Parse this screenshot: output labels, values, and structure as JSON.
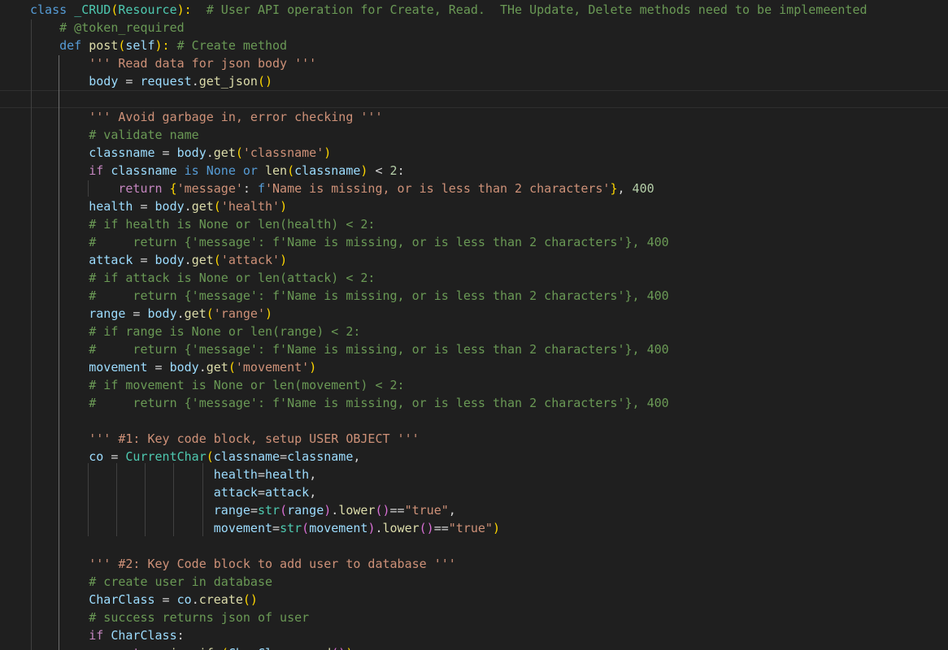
{
  "editor": {
    "language": "python",
    "theme_colors": {
      "background": "#1f1f1f",
      "keyword": "#569cd6",
      "control": "#c586c0",
      "function": "#dcdcaa",
      "variable": "#9cdcfe",
      "class": "#4ec9b0",
      "string": "#ce9178",
      "number": "#b5cea8",
      "comment": "#6a9955",
      "bracket_1": "#ffd700",
      "bracket_2": "#da70d6",
      "bracket_3": "#179fff"
    },
    "lines": [
      [
        [
          "kw",
          "class "
        ],
        [
          "cls",
          "_CRUD"
        ],
        [
          "br1",
          "("
        ],
        [
          "cls",
          "Resource"
        ],
        [
          "br1",
          "):"
        ],
        [
          "pl",
          "  "
        ],
        [
          "com",
          "# User API operation for Create, Read.  THe Update, Delete methods need to be implemeented"
        ]
      ],
      [
        [
          "pl",
          "    "
        ],
        [
          "com",
          "# @token_required"
        ]
      ],
      [
        [
          "pl",
          "    "
        ],
        [
          "kw",
          "def "
        ],
        [
          "fn",
          "post"
        ],
        [
          "br1",
          "("
        ],
        [
          "var",
          "self"
        ],
        [
          "br1",
          "):"
        ],
        [
          "pl",
          " "
        ],
        [
          "com",
          "# Create method"
        ]
      ],
      [
        [
          "pl",
          "        "
        ],
        [
          "str",
          "''' Read data for json body '''"
        ]
      ],
      [
        [
          "pl",
          "        "
        ],
        [
          "var",
          "body"
        ],
        [
          "op",
          " = "
        ],
        [
          "var",
          "request"
        ],
        [
          "op",
          "."
        ],
        [
          "fn",
          "get_json"
        ],
        [
          "br1",
          "()"
        ]
      ],
      [],
      [
        [
          "pl",
          "        "
        ],
        [
          "str",
          "''' Avoid garbage in, error checking '''"
        ]
      ],
      [
        [
          "pl",
          "        "
        ],
        [
          "com",
          "# validate name"
        ]
      ],
      [
        [
          "pl",
          "        "
        ],
        [
          "var",
          "classname"
        ],
        [
          "op",
          " = "
        ],
        [
          "var",
          "body"
        ],
        [
          "op",
          "."
        ],
        [
          "fn",
          "get"
        ],
        [
          "br1",
          "("
        ],
        [
          "str",
          "'classname'"
        ],
        [
          "br1",
          ")"
        ]
      ],
      [
        [
          "pl",
          "        "
        ],
        [
          "ctl",
          "if "
        ],
        [
          "var",
          "classname"
        ],
        [
          "kw",
          " is None or "
        ],
        [
          "fn",
          "len"
        ],
        [
          "br1",
          "("
        ],
        [
          "var",
          "classname"
        ],
        [
          "br1",
          ")"
        ],
        [
          "op",
          " < "
        ],
        [
          "num",
          "2"
        ],
        [
          "op",
          ":"
        ]
      ],
      [
        [
          "pl",
          "            "
        ],
        [
          "ctl",
          "return "
        ],
        [
          "br1",
          "{"
        ],
        [
          "str",
          "'message'"
        ],
        [
          "op",
          ": "
        ],
        [
          "kw",
          "f"
        ],
        [
          "str",
          "'Name is missing, or is less than 2 characters'"
        ],
        [
          "br1",
          "}"
        ],
        [
          "op",
          ", "
        ],
        [
          "num",
          "400"
        ]
      ],
      [
        [
          "pl",
          "        "
        ],
        [
          "var",
          "health"
        ],
        [
          "op",
          " = "
        ],
        [
          "var",
          "body"
        ],
        [
          "op",
          "."
        ],
        [
          "fn",
          "get"
        ],
        [
          "br1",
          "("
        ],
        [
          "str",
          "'health'"
        ],
        [
          "br1",
          ")"
        ]
      ],
      [
        [
          "pl",
          "        "
        ],
        [
          "com",
          "# if health is None or len(health) < 2:"
        ]
      ],
      [
        [
          "pl",
          "        "
        ],
        [
          "com",
          "#     return {'message': f'Name is missing, or is less than 2 characters'}, 400"
        ]
      ],
      [
        [
          "pl",
          "        "
        ],
        [
          "var",
          "attack"
        ],
        [
          "op",
          " = "
        ],
        [
          "var",
          "body"
        ],
        [
          "op",
          "."
        ],
        [
          "fn",
          "get"
        ],
        [
          "br1",
          "("
        ],
        [
          "str",
          "'attack'"
        ],
        [
          "br1",
          ")"
        ]
      ],
      [
        [
          "pl",
          "        "
        ],
        [
          "com",
          "# if attack is None or len(attack) < 2:"
        ]
      ],
      [
        [
          "pl",
          "        "
        ],
        [
          "com",
          "#     return {'message': f'Name is missing, or is less than 2 characters'}, 400"
        ]
      ],
      [
        [
          "pl",
          "        "
        ],
        [
          "var",
          "range"
        ],
        [
          "op",
          " = "
        ],
        [
          "var",
          "body"
        ],
        [
          "op",
          "."
        ],
        [
          "fn",
          "get"
        ],
        [
          "br1",
          "("
        ],
        [
          "str",
          "'range'"
        ],
        [
          "br1",
          ")"
        ]
      ],
      [
        [
          "pl",
          "        "
        ],
        [
          "com",
          "# if range is None or len(range) < 2:"
        ]
      ],
      [
        [
          "pl",
          "        "
        ],
        [
          "com",
          "#     return {'message': f'Name is missing, or is less than 2 characters'}, 400"
        ]
      ],
      [
        [
          "pl",
          "        "
        ],
        [
          "var",
          "movement"
        ],
        [
          "op",
          " = "
        ],
        [
          "var",
          "body"
        ],
        [
          "op",
          "."
        ],
        [
          "fn",
          "get"
        ],
        [
          "br1",
          "("
        ],
        [
          "str",
          "'movement'"
        ],
        [
          "br1",
          ")"
        ]
      ],
      [
        [
          "pl",
          "        "
        ],
        [
          "com",
          "# if movement is None or len(movement) < 2:"
        ]
      ],
      [
        [
          "pl",
          "        "
        ],
        [
          "com",
          "#     return {'message': f'Name is missing, or is less than 2 characters'}, 400"
        ]
      ],
      [],
      [
        [
          "pl",
          "        "
        ],
        [
          "str",
          "''' #1: Key code block, setup USER OBJECT '''"
        ]
      ],
      [
        [
          "pl",
          "        "
        ],
        [
          "var",
          "co"
        ],
        [
          "op",
          " = "
        ],
        [
          "cls",
          "CurrentChar"
        ],
        [
          "br1",
          "("
        ],
        [
          "var",
          "classname"
        ],
        [
          "op",
          "="
        ],
        [
          "var",
          "classname"
        ],
        [
          "op",
          ","
        ]
      ],
      [
        [
          "pl",
          "                         "
        ],
        [
          "var",
          "health"
        ],
        [
          "op",
          "="
        ],
        [
          "var",
          "health"
        ],
        [
          "op",
          ","
        ]
      ],
      [
        [
          "pl",
          "                         "
        ],
        [
          "var",
          "attack"
        ],
        [
          "op",
          "="
        ],
        [
          "var",
          "attack"
        ],
        [
          "op",
          ","
        ]
      ],
      [
        [
          "pl",
          "                         "
        ],
        [
          "var",
          "range"
        ],
        [
          "op",
          "="
        ],
        [
          "cls",
          "str"
        ],
        [
          "br2",
          "("
        ],
        [
          "var",
          "range"
        ],
        [
          "br2",
          ")"
        ],
        [
          "op",
          "."
        ],
        [
          "fn",
          "lower"
        ],
        [
          "br2",
          "()"
        ],
        [
          "op",
          "=="
        ],
        [
          "str",
          "\"true\""
        ],
        [
          "op",
          ","
        ]
      ],
      [
        [
          "pl",
          "                         "
        ],
        [
          "var",
          "movement"
        ],
        [
          "op",
          "="
        ],
        [
          "cls",
          "str"
        ],
        [
          "br2",
          "("
        ],
        [
          "var",
          "movement"
        ],
        [
          "br2",
          ")"
        ],
        [
          "op",
          "."
        ],
        [
          "fn",
          "lower"
        ],
        [
          "br2",
          "()"
        ],
        [
          "op",
          "=="
        ],
        [
          "str",
          "\"true\""
        ],
        [
          "br1",
          ")"
        ]
      ],
      [],
      [
        [
          "pl",
          "        "
        ],
        [
          "str",
          "''' #2: Key Code block to add user to database '''"
        ]
      ],
      [
        [
          "pl",
          "        "
        ],
        [
          "com",
          "# create user in database"
        ]
      ],
      [
        [
          "pl",
          "        "
        ],
        [
          "var",
          "CharClass"
        ],
        [
          "op",
          " = "
        ],
        [
          "var",
          "co"
        ],
        [
          "op",
          "."
        ],
        [
          "fn",
          "create"
        ],
        [
          "br1",
          "()"
        ]
      ],
      [
        [
          "pl",
          "        "
        ],
        [
          "com",
          "# success returns json of user"
        ]
      ],
      [
        [
          "pl",
          "        "
        ],
        [
          "ctl",
          "if "
        ],
        [
          "var",
          "CharClass"
        ],
        [
          "op",
          ":"
        ]
      ],
      [
        [
          "pl",
          "            "
        ],
        [
          "ctl",
          "return "
        ],
        [
          "fn",
          "jsonify"
        ],
        [
          "br1",
          "("
        ],
        [
          "var",
          "CharClass"
        ],
        [
          "op",
          "."
        ],
        [
          "fn",
          "read"
        ],
        [
          "br2",
          "()"
        ],
        [
          "br1",
          ")"
        ]
      ]
    ]
  }
}
